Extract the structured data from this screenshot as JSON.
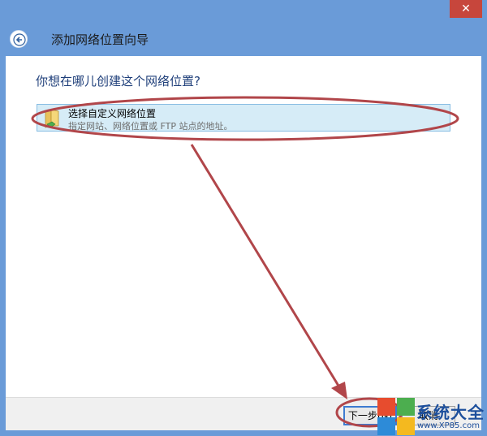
{
  "window": {
    "close_glyph": "✕"
  },
  "header": {
    "title": "添加网络位置向导"
  },
  "main": {
    "question": "你想在哪儿创建这个网络位置?",
    "options": [
      {
        "title": "选择自定义网络位置",
        "description": "指定网站、网络位置或 FTP 站点的地址。",
        "icon": "folder-icon"
      }
    ]
  },
  "footer": {
    "next_label": "下一步(N)",
    "cancel_label": "取消"
  },
  "watermark": {
    "text": "系统大全",
    "url": "www.XP85.com"
  },
  "colors": {
    "title_bar": "#6a9bd8",
    "close_button": "#c7463c",
    "option_highlight": "#d6ecf7",
    "annotation": "#b1464a"
  }
}
